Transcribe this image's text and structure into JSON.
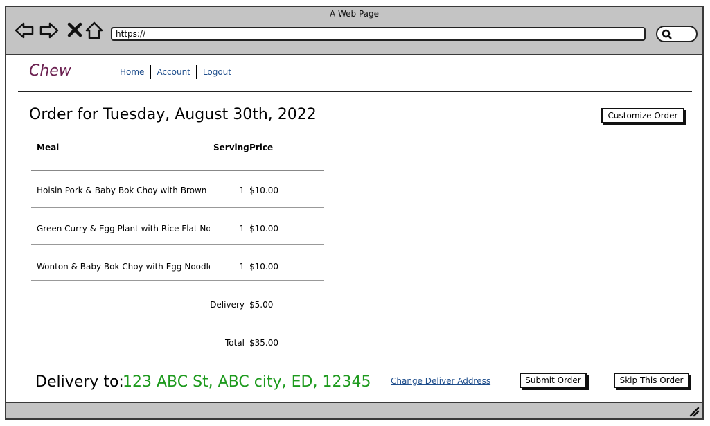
{
  "window": {
    "title": "A Web Page"
  },
  "browser": {
    "url": "https://"
  },
  "app": {
    "logo": "Chew"
  },
  "nav": {
    "home": "Home",
    "account": "Account",
    "logout": "Logout"
  },
  "order": {
    "title": "Order for Tuesday, August 30th, 2022",
    "customize_label": "Customize Order",
    "columns": {
      "meal": "Meal",
      "serving": "Serving",
      "price": "Price"
    },
    "items": [
      {
        "meal": "Hoisin Pork & Baby Bok Choy with Brown R",
        "serving": "1",
        "price": "$10.00"
      },
      {
        "meal": "Green Curry & Egg Plant with Rice Flat No",
        "serving": "1",
        "price": "$10.00"
      },
      {
        "meal": "Wonton & Baby Bok Choy with Egg Noodle",
        "serving": "1",
        "price": "$10.00"
      }
    ],
    "delivery_label": "Delivery",
    "delivery_price": "$5.00",
    "total_label": "Total",
    "total_price": "$35.00"
  },
  "delivery": {
    "label": "Delivery to:",
    "address": "123 ABC St, ABC city, ED, 12345",
    "change_link": "Change Deliver Address"
  },
  "actions": {
    "submit": "Submit Order",
    "skip": "Skip This Order"
  },
  "colors": {
    "logo": "#6b2050",
    "address": "#1e9a1e",
    "link": "#1f4e8c",
    "chrome": "#c4c4c4"
  },
  "icons": [
    "back-arrow-icon",
    "forward-arrow-icon",
    "close-icon",
    "home-icon",
    "search-icon",
    "resize-grip-icon"
  ]
}
